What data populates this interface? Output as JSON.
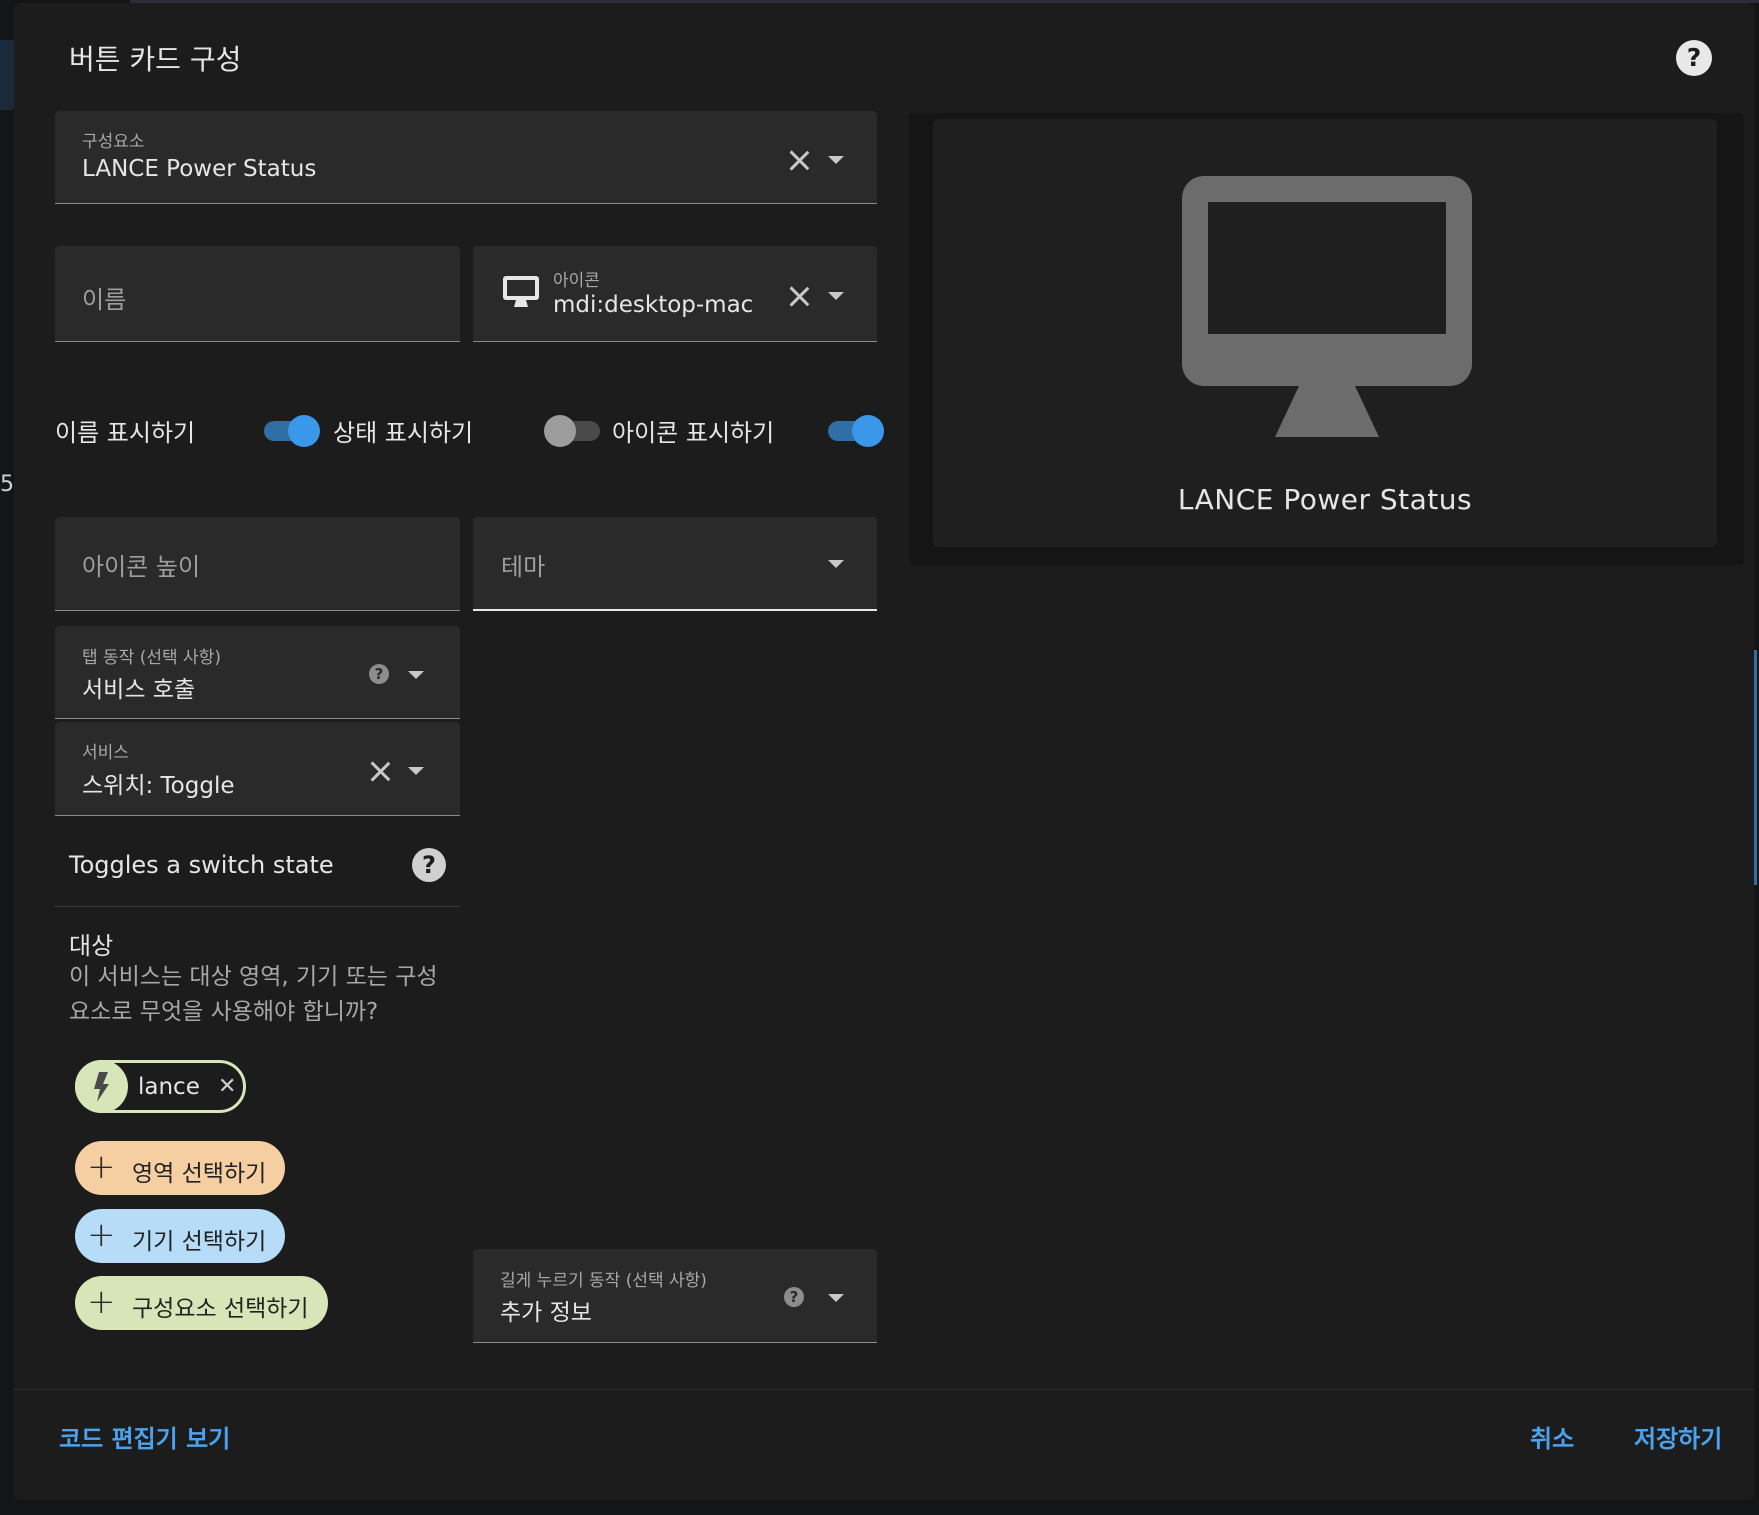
{
  "dialog": {
    "title": "버튼 카드 구성"
  },
  "entity_field": {
    "label": "구성요소",
    "value": "LANCE Power Status"
  },
  "name_field": {
    "placeholder": "이름"
  },
  "icon_field": {
    "label": "아이콘",
    "value": "mdi:desktop-mac",
    "icon": "desktop-mac-icon"
  },
  "toggles": [
    {
      "label": "이름 표시하기",
      "on": true
    },
    {
      "label": "상태 표시하기",
      "on": false
    },
    {
      "label": "아이콘 표시하기",
      "on": true
    }
  ],
  "icon_height_field": {
    "placeholder": "아이콘 높이"
  },
  "theme_field": {
    "placeholder": "테마"
  },
  "tap_action": {
    "label": "탭 동작 (선택 사항)",
    "value": "서비스 호출"
  },
  "service_field": {
    "label": "서비스",
    "value": "스위치: Toggle"
  },
  "service_description": "Toggles a switch state",
  "target": {
    "title": "대상",
    "description": "이 서비스는 대상 영역, 기기 또는 구성요소로 무엇을 사용해야 합니까?",
    "selected_chip": {
      "label": "lance",
      "icon": "flash-icon"
    },
    "add_area": "영역 선택하기",
    "add_device": "기기 선택하기",
    "add_entity": "구성요소 선택하기"
  },
  "hold_action": {
    "label": "길게 누르기 동작 (선택 사항)",
    "value": "추가 정보"
  },
  "preview": {
    "name": "LANCE Power Status",
    "icon": "desktop-mac-icon"
  },
  "footer": {
    "code_editor": "코드 편집기 보기",
    "cancel": "취소",
    "save": "저장하기"
  },
  "colors": {
    "accent": "#4aa3ef",
    "toggle_on": "#3b97e9",
    "area_chip": "#f5cfa2",
    "device_chip": "#b6dcf7",
    "entity_chip": "#d7e6b9"
  }
}
